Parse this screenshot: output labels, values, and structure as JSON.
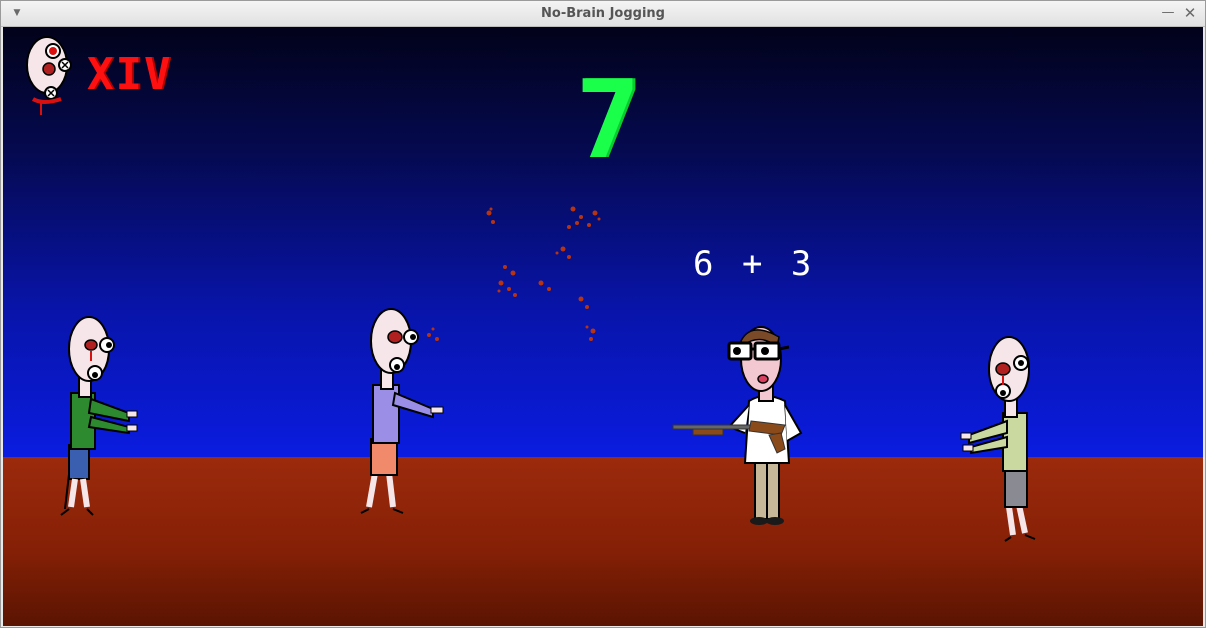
{
  "window": {
    "title": "No-Brain Jogging",
    "menu_icon": "chevron-down-icon",
    "minimize_icon": "minimize-icon",
    "close_icon": "close-icon"
  },
  "hud": {
    "lives": "XIV",
    "lives_icon": "zombie-head-icon",
    "score": "7",
    "question": "6 + 3"
  },
  "colors": {
    "lives_text": "#ff1010",
    "score_text": "#19ff4a",
    "question_text": "#ffffff",
    "sky_top": "#02021a",
    "sky_bottom": "#0a1ce0",
    "ground": "#852006"
  },
  "scene": {
    "zombies": [
      {
        "shirt": "#2e8a2e",
        "pants": "#3a5fb0"
      },
      {
        "shirt": "#9b8ee6",
        "pants": "#f08a6a"
      },
      {
        "shirt": "#c9d9a0",
        "pants": "#8a8a92"
      }
    ],
    "player": {
      "shirt": "#ffffff",
      "pants": "#c8b89a",
      "weapon": "shotgun"
    }
  }
}
